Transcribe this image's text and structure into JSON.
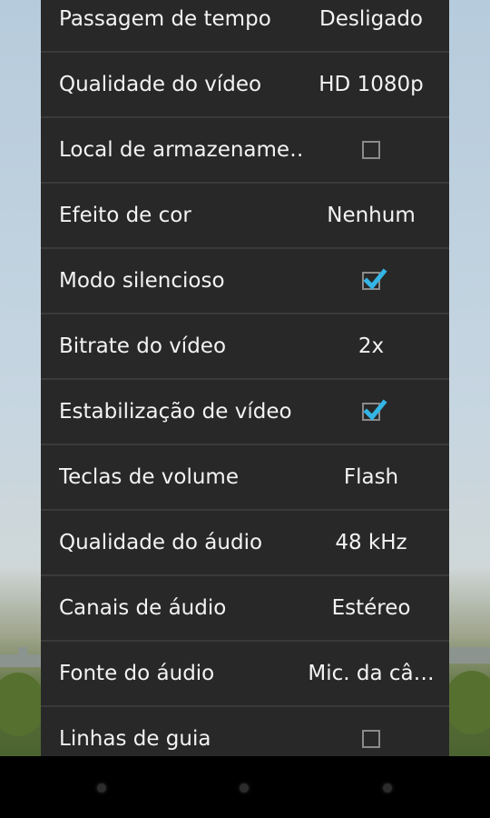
{
  "settings": [
    {
      "label": "Passagem de tempo",
      "value": "Desligado",
      "type": "text"
    },
    {
      "label": "Qualidade do vídeo",
      "value": "HD 1080p",
      "type": "text"
    },
    {
      "label": "Local de armazename…",
      "value": "",
      "type": "checkbox",
      "checked": false
    },
    {
      "label": "Efeito de cor",
      "value": "Nenhum",
      "type": "text"
    },
    {
      "label": "Modo silencioso",
      "value": "",
      "type": "checkbox",
      "checked": true
    },
    {
      "label": "Bitrate do vídeo",
      "value": "2x",
      "type": "text"
    },
    {
      "label": "Estabilização de vídeo",
      "value": "",
      "type": "checkbox",
      "checked": true
    },
    {
      "label": "Teclas de volume",
      "value": "Flash",
      "type": "text"
    },
    {
      "label": "Qualidade do áudio",
      "value": "48 kHz",
      "type": "text"
    },
    {
      "label": "Canais de áudio",
      "value": "Estéreo",
      "type": "text"
    },
    {
      "label": "Fonte do áudio",
      "value": "Mic. da câ…",
      "type": "text"
    },
    {
      "label": "Linhas de guia",
      "value": "",
      "type": "checkbox",
      "checked": false
    }
  ],
  "colors": {
    "check_accent": "#33b5e5",
    "panel_bg": "#282828",
    "divider": "#3a3a3a"
  },
  "navbar": {
    "buttons": [
      "back-icon",
      "home-icon",
      "recents-icon"
    ]
  }
}
